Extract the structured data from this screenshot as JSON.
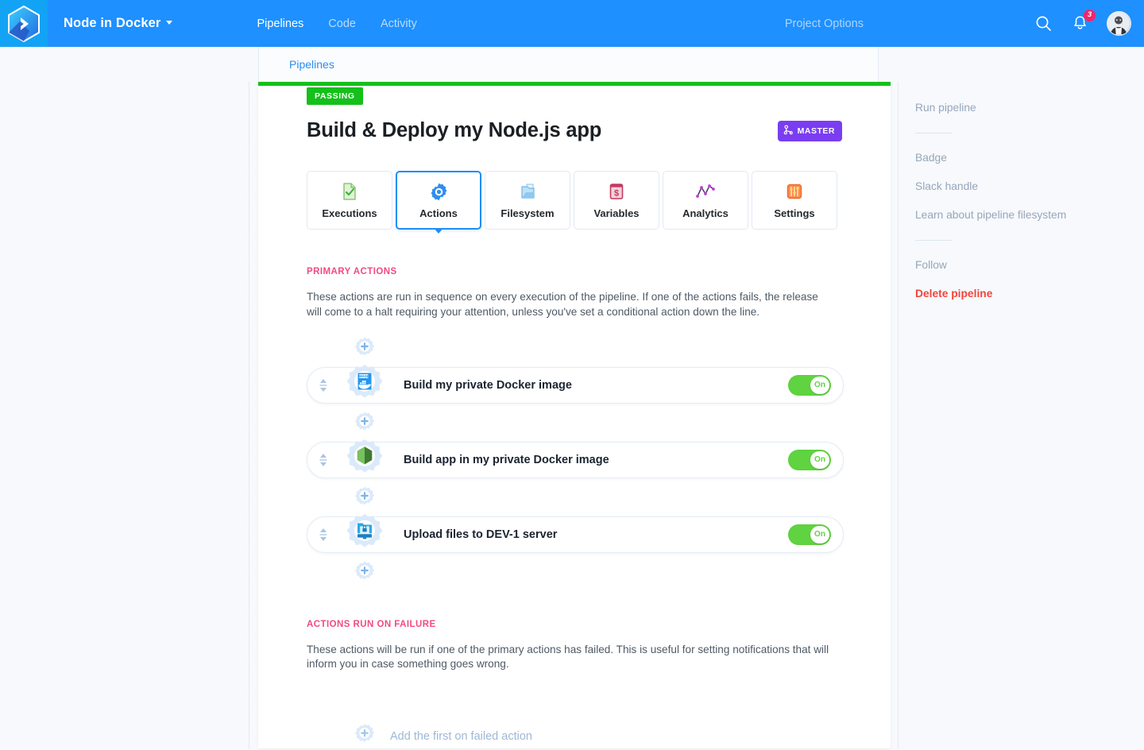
{
  "topbar": {
    "logo_icon": "buddy-hex-chevron-logo",
    "project_name": "Node in Docker",
    "nav": [
      {
        "label": "Pipelines",
        "active": true
      },
      {
        "label": "Code",
        "active": false
      },
      {
        "label": "Activity",
        "active": false
      }
    ],
    "project_options": "Project Options",
    "search_icon": "search-icon",
    "notifications_icon": "bell-icon",
    "notifications_count": "3",
    "avatar_icon": "user-avatar"
  },
  "subtab": {
    "label": "Pipelines"
  },
  "pipeline": {
    "status": "PASSING",
    "title": "Build & Deploy my Node.js app",
    "branch": "MASTER",
    "branch_icon": "branch-icon"
  },
  "tabs": [
    {
      "label": "Executions",
      "icon": "document-check-icon",
      "selected": false
    },
    {
      "label": "Actions",
      "icon": "gear-icon",
      "selected": true
    },
    {
      "label": "Filesystem",
      "icon": "folder-files-icon",
      "selected": false
    },
    {
      "label": "Variables",
      "icon": "dollar-box-icon",
      "selected": false
    },
    {
      "label": "Analytics",
      "icon": "line-chart-icon",
      "selected": false
    },
    {
      "label": "Settings",
      "icon": "sliders-icon",
      "selected": false
    }
  ],
  "primary_actions": {
    "heading": "PRIMARY ACTIONS",
    "description": "These actions are run in sequence on every execution of the pipeline. If one of the actions fails, the release will come to a halt requiring your attention, unless you've set a conditional action down the line.",
    "items": [
      {
        "title": "Build my private Docker image",
        "icon": "docker-image-icon",
        "toggle_label": "On",
        "toggle_on": true
      },
      {
        "title": "Build app in my private Docker image",
        "icon": "node-hexagon-icon",
        "toggle_label": "On",
        "toggle_on": true
      },
      {
        "title": "Upload files to DEV-1 server",
        "icon": "sftp-upload-icon",
        "toggle_label": "On",
        "toggle_on": true
      }
    ],
    "add_node_icon": "add-action-gear-icon",
    "drag_handle_icon": "drag-handle-icon"
  },
  "failure_actions": {
    "heading": "ACTIONS RUN ON FAILURE",
    "description": "These actions will be run if one of the primary actions has failed. This is useful for setting notifications that will inform you in case something goes wrong.",
    "add_label": "Add the first on failed action",
    "add_icon": "add-action-gear-icon"
  },
  "sidebar": {
    "run": "Run pipeline",
    "group2": [
      "Badge",
      "Slack handle",
      "Learn about pipeline filesystem"
    ],
    "follow": "Follow",
    "delete": "Delete pipeline"
  },
  "colors": {
    "brand_blue": "#1e90ff",
    "status_green": "#15c01b",
    "toggle_green": "#5fd340",
    "branch_purple": "#7a3df0",
    "section_pink": "#f24a84",
    "danger_red": "#f2453d",
    "link_blue": "#2b8cf5"
  }
}
